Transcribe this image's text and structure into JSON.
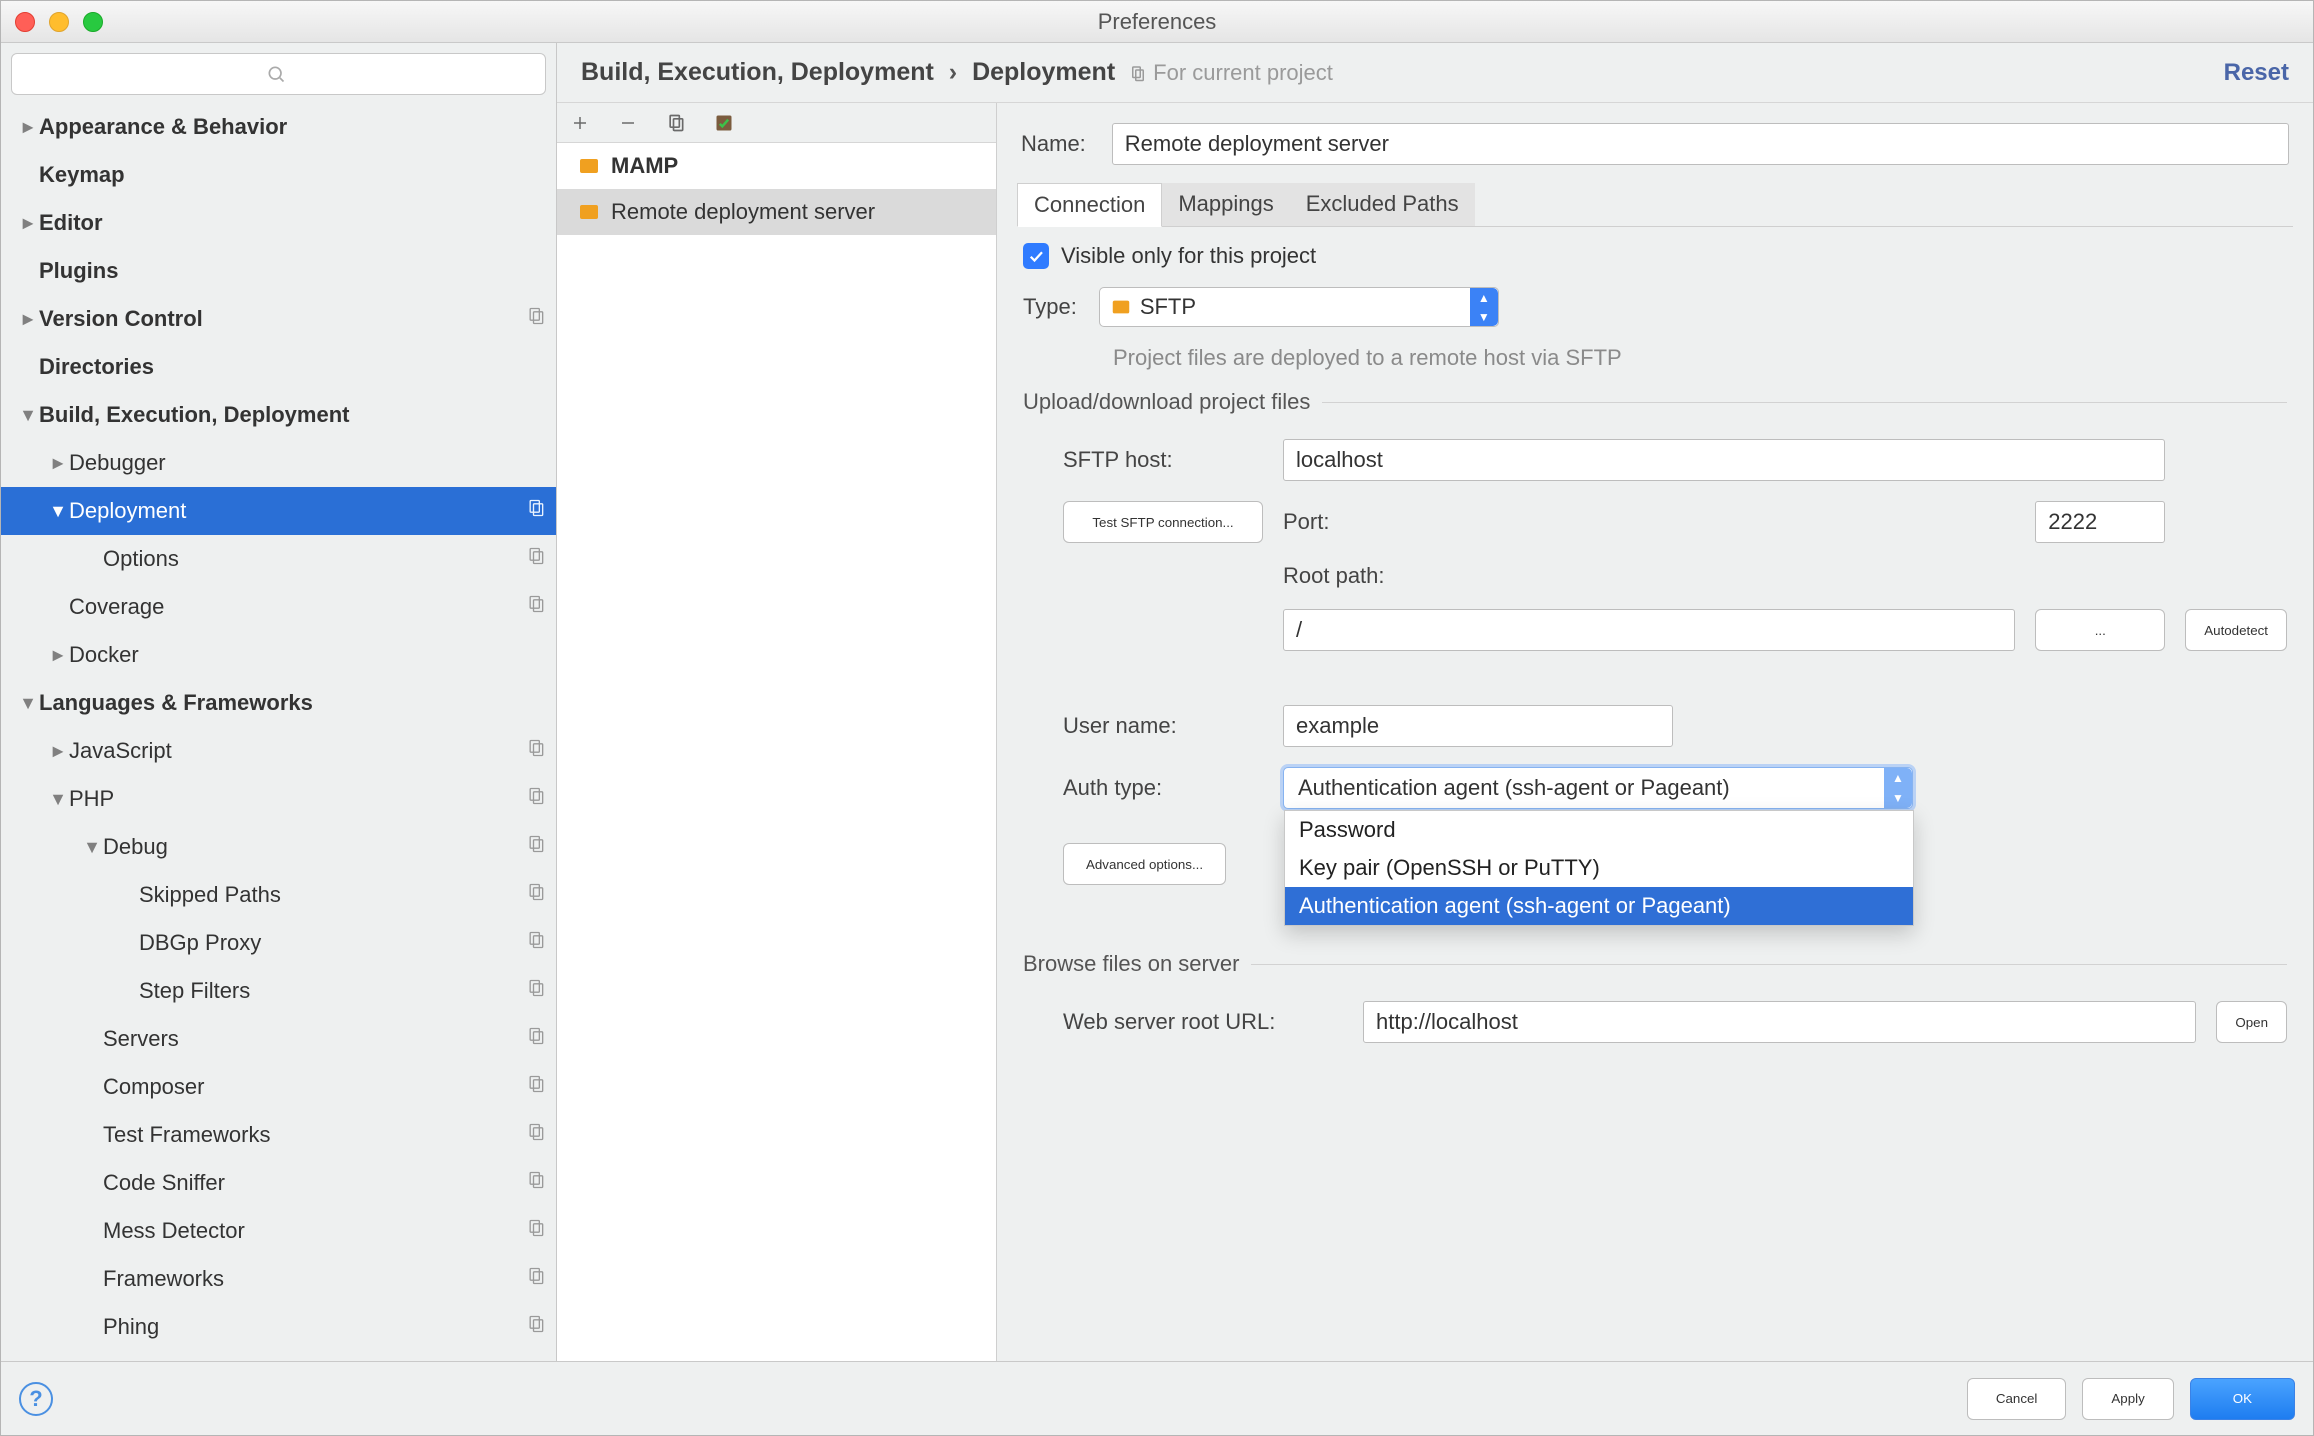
{
  "window": {
    "title": "Preferences"
  },
  "breadcrumbs": {
    "parent": "Build, Execution, Deployment",
    "current": "Deployment",
    "scope": "For current project",
    "reset": "Reset"
  },
  "sidebar": {
    "search_placeholder": "",
    "items": [
      {
        "label": "Appearance & Behavior",
        "arrow": "►",
        "bold": true
      },
      {
        "label": "Keymap",
        "arrow": "",
        "bold": true
      },
      {
        "label": "Editor",
        "arrow": "►",
        "bold": true
      },
      {
        "label": "Plugins",
        "arrow": "",
        "bold": true
      },
      {
        "label": "Version Control",
        "arrow": "►",
        "bold": true,
        "badge": true
      },
      {
        "label": "Directories",
        "arrow": "",
        "bold": true
      },
      {
        "label": "Build, Execution, Deployment",
        "arrow": "▼",
        "bold": true
      },
      {
        "label": "Debugger",
        "arrow": "►",
        "d": 1
      },
      {
        "label": "Deployment",
        "arrow": "▼",
        "d": 1,
        "sel": true,
        "badge": true
      },
      {
        "label": "Options",
        "arrow": "",
        "d": 2,
        "badge": true
      },
      {
        "label": "Coverage",
        "arrow": "",
        "d": 1,
        "badge": true
      },
      {
        "label": "Docker",
        "arrow": "►",
        "d": 1
      },
      {
        "label": "Languages & Frameworks",
        "arrow": "▼",
        "bold": true
      },
      {
        "label": "JavaScript",
        "arrow": "►",
        "d": 1,
        "badge": true
      },
      {
        "label": "PHP",
        "arrow": "▼",
        "d": 1,
        "badge": true
      },
      {
        "label": "Debug",
        "arrow": "▼",
        "d": 2,
        "badge": true
      },
      {
        "label": "Skipped Paths",
        "arrow": "",
        "d": 3,
        "badge": true
      },
      {
        "label": "DBGp Proxy",
        "arrow": "",
        "d": 3,
        "badge": true
      },
      {
        "label": "Step Filters",
        "arrow": "",
        "d": 3,
        "badge": true
      },
      {
        "label": "Servers",
        "arrow": "",
        "d": 2,
        "badge": true
      },
      {
        "label": "Composer",
        "arrow": "",
        "d": 2,
        "badge": true
      },
      {
        "label": "Test Frameworks",
        "arrow": "",
        "d": 2,
        "badge": true
      },
      {
        "label": "Code Sniffer",
        "arrow": "",
        "d": 2,
        "badge": true
      },
      {
        "label": "Mess Detector",
        "arrow": "",
        "d": 2,
        "badge": true
      },
      {
        "label": "Frameworks",
        "arrow": "",
        "d": 2,
        "badge": true
      },
      {
        "label": "Phing",
        "arrow": "",
        "d": 2,
        "badge": true
      }
    ]
  },
  "servers": {
    "items": [
      {
        "label": "MAMP",
        "bold": true,
        "color": "#f0a020",
        "selected": false
      },
      {
        "label": "Remote deployment server",
        "bold": false,
        "color": "#f0a020",
        "selected": true
      }
    ]
  },
  "form": {
    "name": {
      "label": "Name:",
      "value": "Remote deployment server"
    },
    "tabs": {
      "t0": "Connection",
      "t1": "Mappings",
      "t2": "Excluded Paths"
    },
    "visible_only": {
      "label": "Visible only for this project",
      "checked": true
    },
    "type": {
      "label": "Type:",
      "value": "SFTP",
      "hint": "Project files are deployed to a remote host via SFTP"
    },
    "upload_section": "Upload/download project files",
    "sftp_host": {
      "label": "SFTP host:",
      "value": "localhost"
    },
    "test_btn": "Test SFTP connection...",
    "port": {
      "label": "Port:",
      "value": "2222"
    },
    "root": {
      "label": "Root path:",
      "value": "/"
    },
    "ellipsis": "...",
    "autodetect": "Autodetect",
    "user": {
      "label": "User name:",
      "value": "example"
    },
    "auth": {
      "label": "Auth type:",
      "value": "Authentication agent (ssh-agent or Pageant)",
      "options": [
        "Password",
        "Key pair (OpenSSH or PuTTY)",
        "Authentication agent (ssh-agent or Pageant)"
      ]
    },
    "advanced": "Advanced options...",
    "browse_section": "Browse files on server",
    "web_root": {
      "label": "Web server root URL:",
      "value": "http://localhost"
    },
    "open": "Open"
  },
  "footer": {
    "cancel": "Cancel",
    "apply": "Apply",
    "ok": "OK",
    "help": "?"
  }
}
